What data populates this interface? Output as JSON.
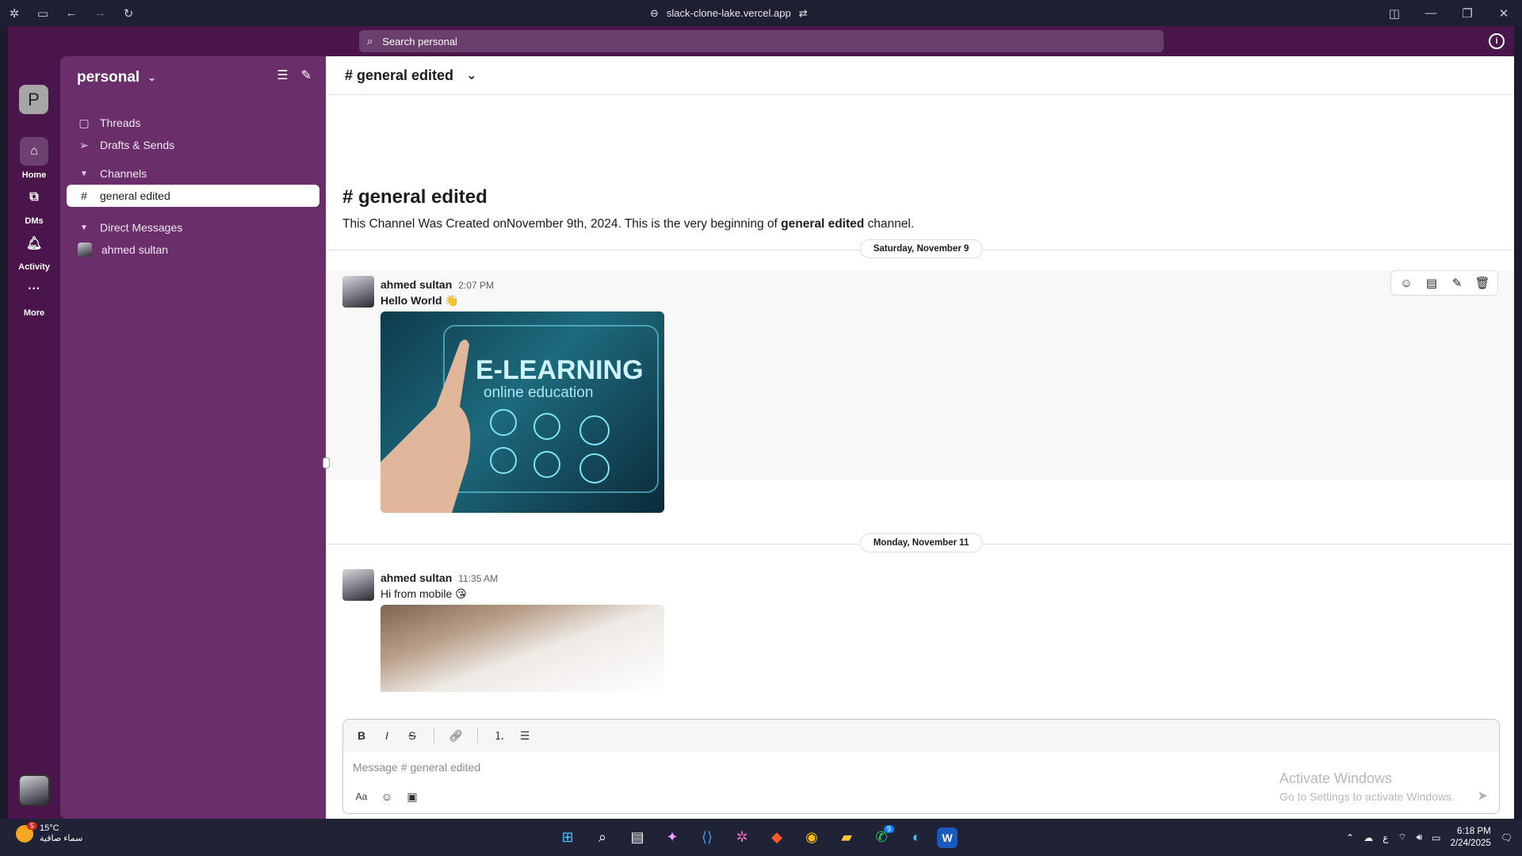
{
  "browser": {
    "url": "slack-clone-lake.vercel.app"
  },
  "topbar": {
    "search_placeholder": "Search personal"
  },
  "rail": {
    "workspace_initial": "P",
    "items": [
      {
        "label": "Home",
        "icon": "home-icon"
      },
      {
        "label": "DMs",
        "icon": "dms-icon"
      },
      {
        "label": "Activity",
        "icon": "bell-icon"
      },
      {
        "label": "More",
        "icon": "more-icon"
      }
    ]
  },
  "sidebar": {
    "workspace_name": "personal",
    "threads": "Threads",
    "drafts": "Drafts & Sends",
    "channels_header": "Channels",
    "channel": "general edited",
    "dm_header": "Direct Messages",
    "dm_user": "ahmed sultan"
  },
  "channel": {
    "header_title": "# general edited",
    "intro_title": "# general edited",
    "intro_prefix": "This Channel Was Created onNovember 9th, 2024. This is the very beginning of ",
    "intro_bold": "general edited",
    "intro_suffix": " channel."
  },
  "messages": [
    {
      "date": "Saturday, November 9",
      "author": "ahmed sultan",
      "time": "2:07 PM",
      "text": "Hello World 👋",
      "image_label_1": "E-LEARNING",
      "image_label_2": "online education"
    },
    {
      "date": "Monday, November 11",
      "author": "ahmed sultan",
      "time": "11:35 AM",
      "text": "Hi from mobile 😘"
    }
  ],
  "composer": {
    "placeholder": "Message # general edited",
    "format_label": "Aa"
  },
  "os": {
    "activate_title": "Activate Windows",
    "activate_sub": "Go to Settings to activate Windows.",
    "weather_temp": "15°C",
    "weather_desc": "سماء صافية",
    "weather_badge": "5",
    "lang": "ع",
    "time": "6:18 PM",
    "date": "2/24/2025",
    "whatsapp_badge": "9"
  },
  "colors": {
    "aubergine": "#4a154b",
    "sidebar": "#6a2f6b"
  }
}
